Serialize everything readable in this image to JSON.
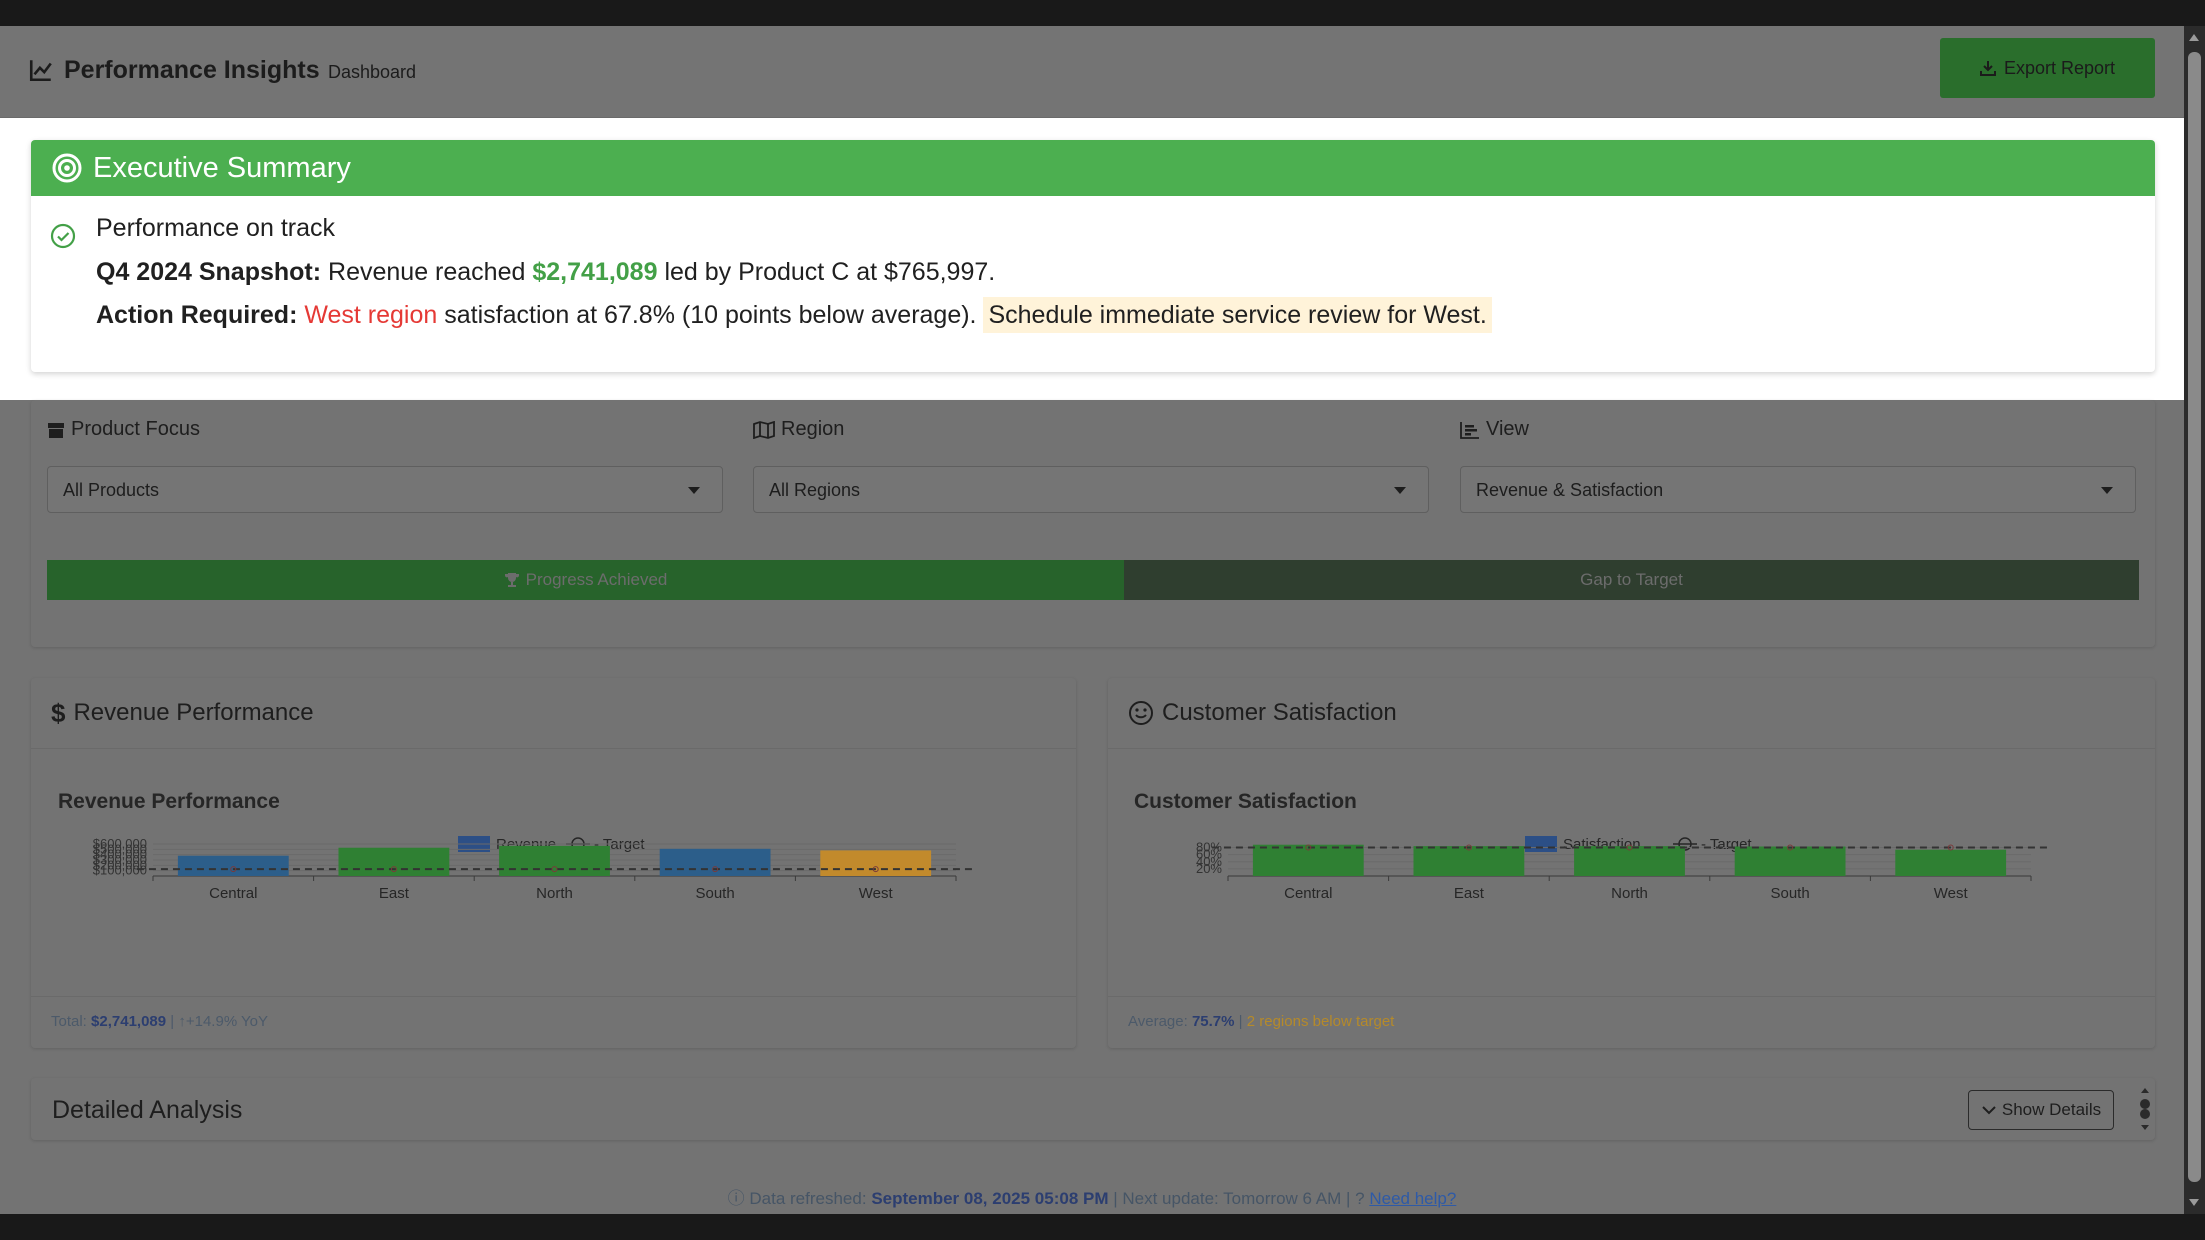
{
  "header": {
    "brand_title": "Performance Insights",
    "nav_tab": "Dashboard",
    "export_label": "Export Report"
  },
  "executive_summary": {
    "title": "Executive Summary",
    "status": "Performance on track",
    "snapshot_label": "Q4 2024 Snapshot:",
    "snapshot_text_1": "Revenue reached",
    "revenue_value": "$2,741,089",
    "snapshot_text_2": "led by Product C at $765,997.",
    "action_label": "Action Required:",
    "action_region": "West region",
    "action_text": "satisfaction at 67.8% (10 points below average).",
    "action_highlight": "Schedule immediate service review for West."
  },
  "filters": {
    "product": {
      "label": "Product Focus",
      "value": "All Products"
    },
    "region": {
      "label": "Region",
      "value": "All Regions"
    },
    "view": {
      "label": "View",
      "value": "Revenue & Satisfaction"
    }
  },
  "progress": {
    "achieved_label": "Progress Achieved",
    "gap_label": "Gap to Target",
    "achieved_fraction": 0.515
  },
  "revenue_panel": {
    "header": "Revenue Performance",
    "footer_prefix": "Total:",
    "footer_total": "$2,741,089",
    "footer_sep": "|",
    "footer_yoy": "+14.9% YoY"
  },
  "satisfaction_panel": {
    "header": "Customer Satisfaction",
    "footer_prefix": "Average:",
    "footer_avg": "75.7%",
    "footer_sep": "|",
    "footer_warn": "2 regions below target"
  },
  "chart_data": [
    {
      "type": "bar",
      "title": "Revenue Performance",
      "categories": [
        "Central",
        "East",
        "North",
        "South",
        "West"
      ],
      "series": [
        {
          "name": "Revenue",
          "values": [
            380000,
            530000,
            565000,
            510000,
            480000
          ]
        },
        {
          "name": "Target",
          "values": [
            130000,
            130000,
            130000,
            130000,
            130000
          ]
        }
      ],
      "y_tick_labels": [
        "$100,000",
        "$200,000",
        "$300,000",
        "$400,000",
        "$500,000",
        "$600,000"
      ],
      "ylim": [
        0,
        600000
      ],
      "bar_colors": [
        "#2c5e8a",
        "#2f8033",
        "#2f8033",
        "#2c5e8a",
        "#c28a2c"
      ],
      "target_color": "#333333",
      "legend": "top"
    },
    {
      "type": "bar",
      "title": "Customer Satisfaction",
      "categories": [
        "Central",
        "East",
        "North",
        "South",
        "West"
      ],
      "series": [
        {
          "name": "Satisfaction",
          "values": [
            88,
            84,
            84,
            83,
            74
          ]
        },
        {
          "name": "Target",
          "values": [
            80,
            80,
            80,
            80,
            80
          ]
        }
      ],
      "y_tick_labels": [
        "20%",
        "40%",
        "60%",
        "80%"
      ],
      "ylim": [
        0,
        90
      ],
      "bar_colors": [
        "#2f8033",
        "#2f8033",
        "#2f8033",
        "#2f8033",
        "#2f8033"
      ],
      "target_color": "#333333",
      "legend": "top"
    }
  ],
  "details": {
    "title": "Detailed Analysis",
    "button_label": "Show Details"
  },
  "footer": {
    "prefix": "Data refreshed:",
    "date": "September 08, 2025 05:08 PM",
    "middle": "| Next update: Tomorrow 6 AM |",
    "help": "Need help?"
  }
}
